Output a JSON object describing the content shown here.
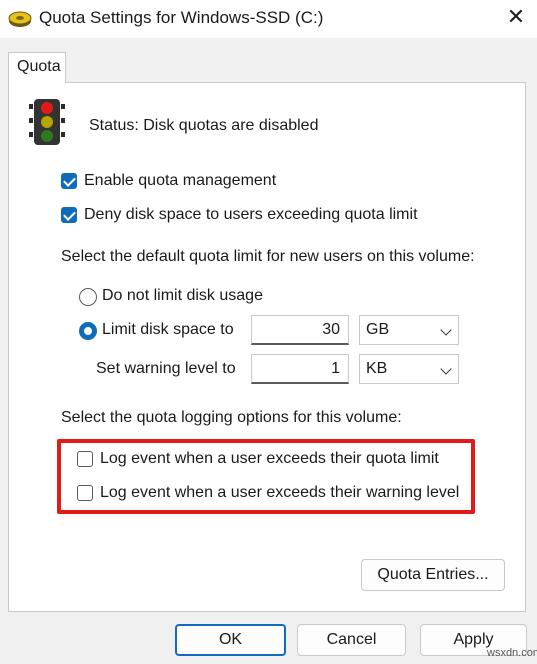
{
  "window": {
    "title": "Quota Settings for Windows-SSD (C:)",
    "close_glyph": "✕"
  },
  "tab": {
    "label": "Quota"
  },
  "status": {
    "text": "Status:  Disk quotas are disabled"
  },
  "options": {
    "enable_quota": {
      "label": "Enable quota management",
      "checked": true
    },
    "deny_space": {
      "label": "Deny disk space to users exceeding quota limit",
      "checked": true
    }
  },
  "default_limit": {
    "heading": "Select the default quota limit for new users on this volume:",
    "no_limit_label": "Do not limit disk usage",
    "limit_label": "Limit disk space to",
    "limit_value": "30",
    "limit_unit": "GB",
    "warning_label": "Set warning level to",
    "warning_value": "1",
    "warning_unit": "KB",
    "selected": "limit"
  },
  "logging": {
    "heading": "Select the quota logging options for this volume:",
    "exceed_limit_label": "Log event when a user exceeds their quota limit",
    "exceed_warning_label": "Log event when a user exceeds their warning level"
  },
  "buttons": {
    "quota_entries": "Quota Entries...",
    "ok": "OK",
    "cancel": "Cancel",
    "apply": "Apply"
  },
  "watermark": "wsxdn.com",
  "colors": {
    "accent": "#0f6cbd",
    "highlight": "#e21a1a"
  }
}
